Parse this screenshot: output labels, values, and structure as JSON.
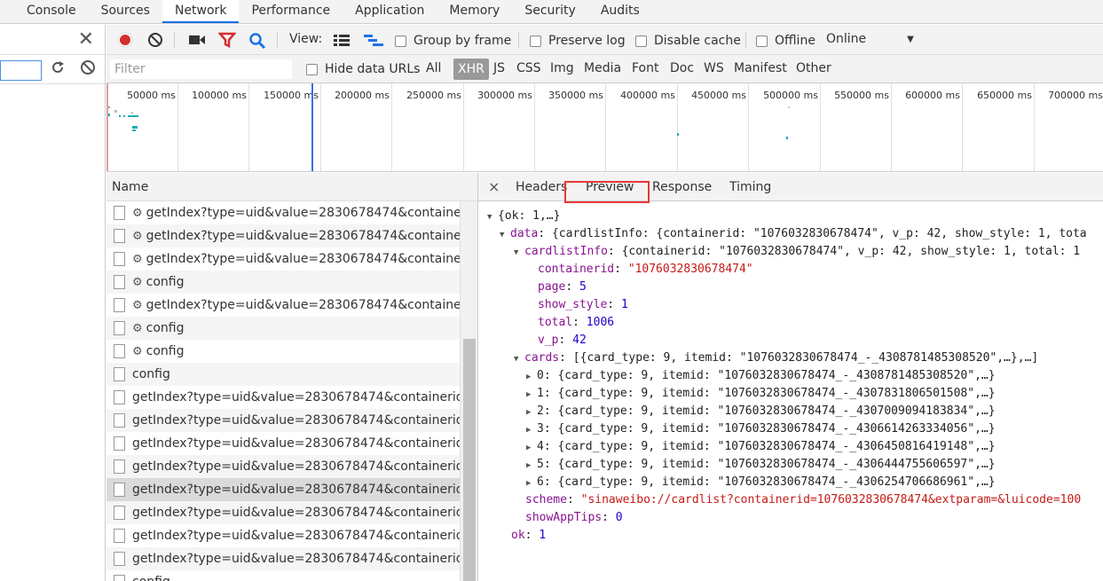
{
  "main_tabs": [
    "Console",
    "Sources",
    "Network",
    "Performance",
    "Application",
    "Memory",
    "Security",
    "Audits"
  ],
  "toolbar": {
    "view_label": "View:",
    "group_by_frame": "Group by frame",
    "preserve_log": "Preserve log",
    "disable_cache": "Disable cache",
    "offline": "Offline",
    "throttle": "Online",
    "record_color": "#d32f2f",
    "filter_color": "#d32f2f",
    "search_color": "#1a73e8"
  },
  "filterbar": {
    "placeholder": "Filter",
    "hide_data_urls": "Hide data URLs",
    "types": [
      "All",
      "XHR",
      "JS",
      "CSS",
      "Img",
      "Media",
      "Font",
      "Doc",
      "WS",
      "Manifest",
      "Other"
    ],
    "active_type": "XHR"
  },
  "overview": {
    "ticks": [
      "50000 ms",
      "100000 ms",
      "150000 ms",
      "200000 ms",
      "250000 ms",
      "300000 ms",
      "350000 ms",
      "400000 ms",
      "450000 ms",
      "500000 ms",
      "550000 ms",
      "600000 ms",
      "650000 ms",
      "700000 ms"
    ]
  },
  "list": {
    "header": "Name",
    "rows": [
      {
        "name": "getIndex?type=uid&value=2830678474&containerid.",
        "gear": true
      },
      {
        "name": "getIndex?type=uid&value=2830678474&containerid.",
        "gear": true
      },
      {
        "name": "getIndex?type=uid&value=2830678474&containerid.",
        "gear": true
      },
      {
        "name": "config",
        "gear": true
      },
      {
        "name": "getIndex?type=uid&value=2830678474&containerid.",
        "gear": true
      },
      {
        "name": "config",
        "gear": true
      },
      {
        "name": "config",
        "gear": true
      },
      {
        "name": "config",
        "gear": false
      },
      {
        "name": "getIndex?type=uid&value=2830678474&containerid=1",
        "gear": false
      },
      {
        "name": "getIndex?type=uid&value=2830678474&containerid=1",
        "gear": false
      },
      {
        "name": "getIndex?type=uid&value=2830678474&containerid=1",
        "gear": false
      },
      {
        "name": "getIndex?type=uid&value=2830678474&containerid=1",
        "gear": false
      },
      {
        "name": "getIndex?type=uid&value=2830678474&containerid=1",
        "gear": false
      },
      {
        "name": "getIndex?type=uid&value=2830678474&containerid=1",
        "gear": false
      },
      {
        "name": "getIndex?type=uid&value=2830678474&containerid=1",
        "gear": false
      },
      {
        "name": "getIndex?type=uid&value=2830678474&containerid=1",
        "gear": false
      },
      {
        "name": "config",
        "gear": false
      }
    ]
  },
  "details": {
    "close": "×",
    "tabs": [
      "Headers",
      "Preview",
      "Response",
      "Timing"
    ],
    "active_tab": "Preview",
    "tree": {
      "root": "{ok: 1,…}",
      "data_key": "data",
      "data_summary": "{cardlistInfo: {containerid: \"1076032830678474\", v_p: 42, show_style: 1, tota",
      "cardlistInfo_key": "cardlistInfo",
      "cardlistInfo_summary": "{containerid: \"1076032830678474\", v_p: 42, show_style: 1, total: 1",
      "containerid_key": "containerid",
      "containerid_val": "\"1076032830678474\"",
      "page_key": "page",
      "page_val": "5",
      "show_style_key": "show_style",
      "show_style_val": "1",
      "total_key": "total",
      "total_val": "1006",
      "v_p_key": "v_p",
      "v_p_val": "42",
      "cards_key": "cards",
      "cards_summary": "[{card_type: 9, itemid: \"1076032830678474_-_4308781485308520\",…},…]",
      "cards": [
        {
          "idx": "0",
          "summary": "{card_type: 9, itemid: \"1076032830678474_-_4308781485308520\",…}"
        },
        {
          "idx": "1",
          "summary": "{card_type: 9, itemid: \"1076032830678474_-_4307831806501508\",…}"
        },
        {
          "idx": "2",
          "summary": "{card_type: 9, itemid: \"1076032830678474_-_4307009094183834\",…}"
        },
        {
          "idx": "3",
          "summary": "{card_type: 9, itemid: \"1076032830678474_-_4306614263334056\",…}"
        },
        {
          "idx": "4",
          "summary": "{card_type: 9, itemid: \"1076032830678474_-_4306450816419148\",…}"
        },
        {
          "idx": "5",
          "summary": "{card_type: 9, itemid: \"1076032830678474_-_4306444755606597\",…}"
        },
        {
          "idx": "6",
          "summary": "{card_type: 9, itemid: \"1076032830678474_-_4306254706686961\",…}"
        }
      ],
      "scheme_key": "scheme",
      "scheme_val": "\"sinaweibo://cardlist?containerid=1076032830678474&extparam=&luicode=100",
      "showAppTips_key": "showAppTips",
      "showAppTips_val": "0",
      "ok_key": "ok",
      "ok_val": "1"
    }
  }
}
